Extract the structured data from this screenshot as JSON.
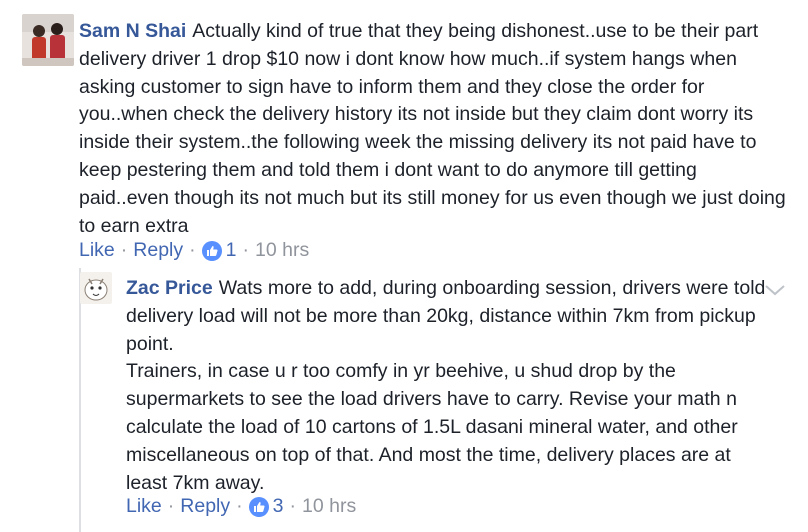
{
  "comment1": {
    "author": "Sam N Shai",
    "text": "Actually kind of true that they being dishonest..use to be their part delivery driver 1 drop $10 now i dont know how much..if system hangs when asking customer to sign have to inform them and they close the order for you..when check the delivery history its not inside but they claim dont worry its inside their system..the following week the missing delivery its not paid have to keep pestering them and told them i dont want to do anymore till getting paid..even though its not much but its still money for us even though we just doing to earn extra",
    "like_label": "Like",
    "reply_label": "Reply",
    "likes": "1",
    "time": "10 hrs"
  },
  "comment2": {
    "author": "Zac Price",
    "text": "Wats more to add, during onboarding session, drivers were told delivery load will not be more than 20kg, distance within 7km from pickup point.",
    "text2": "Trainers, in case u r too comfy in yr beehive, u shud drop by the supermarkets to see the load drivers have to carry. Revise your math n calculate the load of 10 cartons of 1.5L dasani mineral water, and other miscellaneous on top of that. And most the time, delivery places are at least 7km away.",
    "like_label": "Like",
    "reply_label": "Reply",
    "likes": "3",
    "time": "10 hrs"
  },
  "separator": "·",
  "colors": {
    "author": "#365899",
    "link": "#4267b2",
    "meta": "#90949c",
    "like_badge": "#5890ff"
  }
}
